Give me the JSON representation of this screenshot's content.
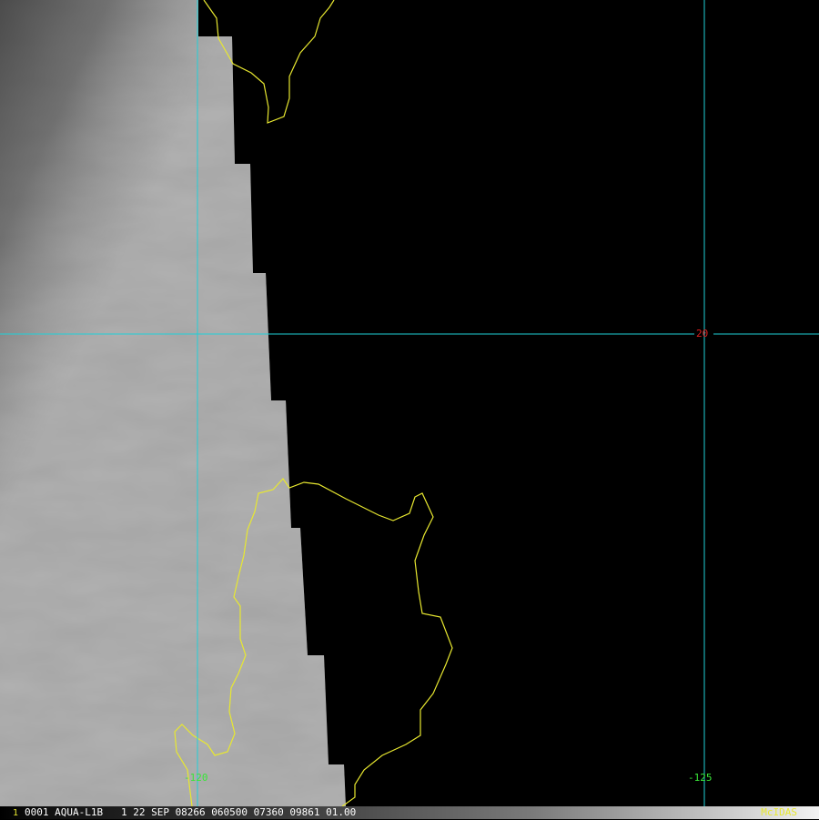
{
  "colors": {
    "background": "#000000",
    "grid": "#20d0d8",
    "coastline": "#e8e830",
    "lon_label": "#39e639",
    "lat_label": "#e02020",
    "frame_number": "#e8e830",
    "status_text": "#ffffff",
    "brand": "#e8e830",
    "imagery": "#b4b4b4"
  },
  "map": {
    "lon_labels": [
      "-120",
      "-125"
    ],
    "lat_labels": [
      "20"
    ]
  },
  "status_bar": {
    "frame_number": "1",
    "text": "0001 AQUA-L1B   1 22 SEP 08266 060500 07360 09861 01.00",
    "brand": "McIDAS"
  }
}
